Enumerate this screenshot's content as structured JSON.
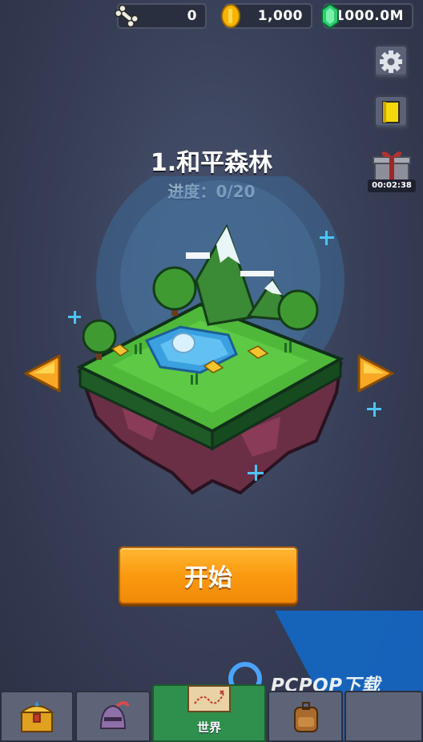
{
  "resources": {
    "bones": "0",
    "coins": "1,000",
    "gems": "1000.0M"
  },
  "side_panel": {
    "gift_timer": "00:02:38"
  },
  "level": {
    "title": "1.和平森林",
    "progress_label": "进度：0/20"
  },
  "start_button": {
    "label": "开始"
  },
  "tabs": [
    {
      "id": "treasure",
      "label": "",
      "icon": "treasure-chest-icon"
    },
    {
      "id": "hero",
      "label": "",
      "icon": "knight-helmet-icon"
    },
    {
      "id": "world",
      "label": "世界",
      "icon": "treasure-map-icon",
      "active": true
    },
    {
      "id": "bag",
      "label": "",
      "icon": "backpack-icon"
    }
  ],
  "watermark": {
    "text": "PCPOP下载"
  },
  "colors": {
    "background": "#363d55",
    "start_button": "#fb9a0f",
    "active_tab": "#2f8f4c",
    "coin": "#f7b500",
    "gem": "#2ecc71",
    "arrow": "#f9a825"
  }
}
